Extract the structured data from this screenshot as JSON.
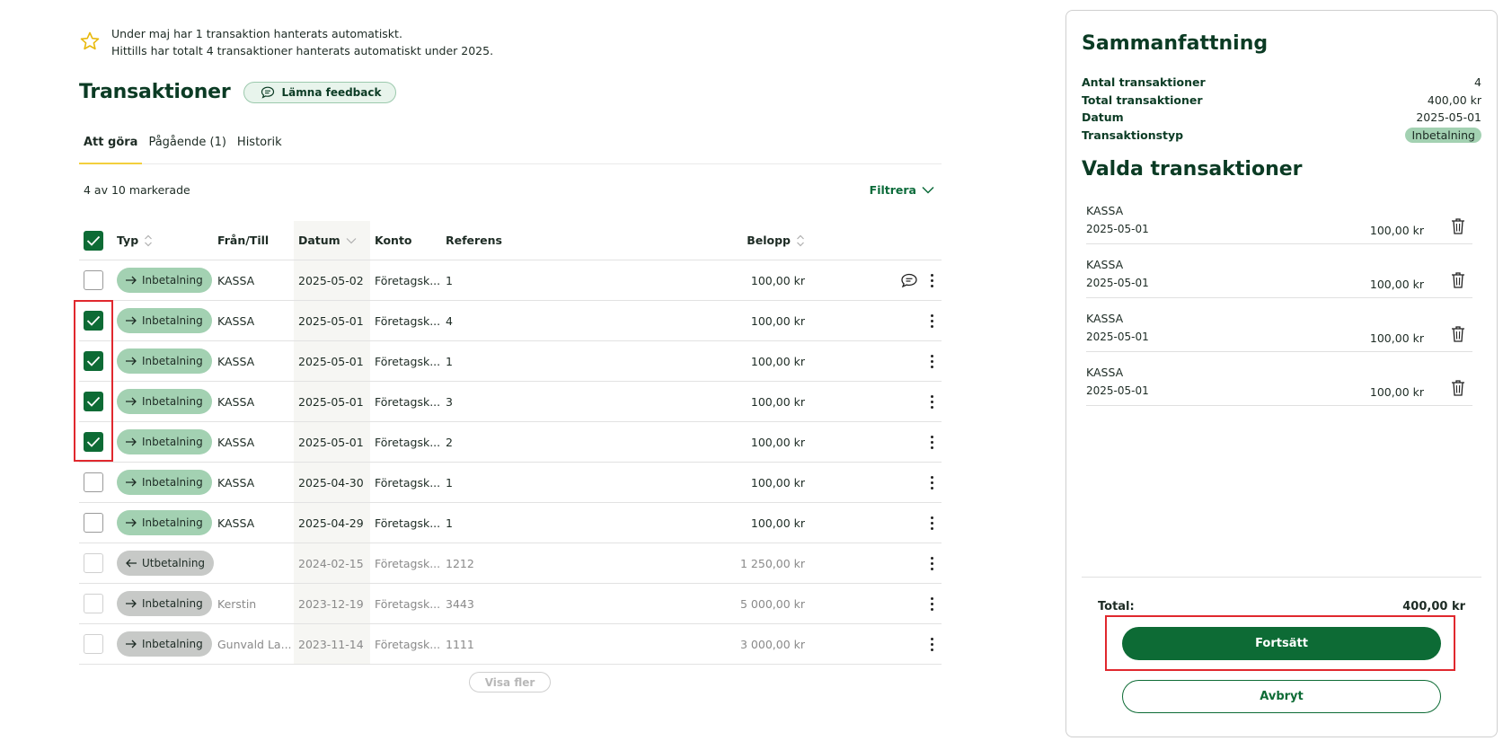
{
  "info": {
    "line1": "Under maj har 1 transaktion hanterats automatiskt.",
    "line2": "Hittills har totalt 4 transaktioner hanterats automatiskt under 2025."
  },
  "page": {
    "title": "Transaktioner",
    "feedback_label": "Lämna feedback"
  },
  "tabs": [
    {
      "label": "Att göra",
      "active": true
    },
    {
      "label": "Pågående (1)",
      "active": false
    },
    {
      "label": "Historik",
      "active": false
    }
  ],
  "toolbar": {
    "marked_text": "4 av 10 markerade",
    "filter_label": "Filtrera"
  },
  "table": {
    "headers": {
      "type": "Typ",
      "from_to": "Från/Till",
      "date": "Datum",
      "account": "Konto",
      "reference": "Referens",
      "amount": "Belopp"
    },
    "rows": [
      {
        "checked": false,
        "type": "Inbetalning",
        "direction": "in",
        "from_to": "KASSA",
        "date": "2025-05-02",
        "account": "Företagsk...",
        "reference": "1",
        "amount": "100,00 kr",
        "muted": false,
        "has_comment": true
      },
      {
        "checked": true,
        "type": "Inbetalning",
        "direction": "in",
        "from_to": "KASSA",
        "date": "2025-05-01",
        "account": "Företagsk...",
        "reference": "4",
        "amount": "100,00 kr",
        "muted": false,
        "has_comment": false
      },
      {
        "checked": true,
        "type": "Inbetalning",
        "direction": "in",
        "from_to": "KASSA",
        "date": "2025-05-01",
        "account": "Företagsk...",
        "reference": "1",
        "amount": "100,00 kr",
        "muted": false,
        "has_comment": false
      },
      {
        "checked": true,
        "type": "Inbetalning",
        "direction": "in",
        "from_to": "KASSA",
        "date": "2025-05-01",
        "account": "Företagsk...",
        "reference": "3",
        "amount": "100,00 kr",
        "muted": false,
        "has_comment": false
      },
      {
        "checked": true,
        "type": "Inbetalning",
        "direction": "in",
        "from_to": "KASSA",
        "date": "2025-05-01",
        "account": "Företagsk...",
        "reference": "2",
        "amount": "100,00 kr",
        "muted": false,
        "has_comment": false
      },
      {
        "checked": false,
        "type": "Inbetalning",
        "direction": "in",
        "from_to": "KASSA",
        "date": "2025-04-30",
        "account": "Företagsk...",
        "reference": "1",
        "amount": "100,00 kr",
        "muted": false,
        "has_comment": false
      },
      {
        "checked": false,
        "type": "Inbetalning",
        "direction": "in",
        "from_to": "KASSA",
        "date": "2025-04-29",
        "account": "Företagsk...",
        "reference": "1",
        "amount": "100,00 kr",
        "muted": false,
        "has_comment": false
      },
      {
        "checked": false,
        "type": "Utbetalning",
        "direction": "out",
        "from_to": "",
        "date": "2024-02-15",
        "account": "Företagsk...",
        "reference": "1212",
        "amount": "1 250,00 kr",
        "muted": true,
        "has_comment": false
      },
      {
        "checked": false,
        "type": "Inbetalning",
        "direction": "in",
        "from_to": "Kerstin",
        "date": "2023-12-19",
        "account": "Företagsk...",
        "reference": "3443",
        "amount": "5 000,00 kr",
        "muted": true,
        "has_comment": false
      },
      {
        "checked": false,
        "type": "Inbetalning",
        "direction": "in",
        "from_to": "Gunvald La...",
        "date": "2023-11-14",
        "account": "Företagsk...",
        "reference": "1111",
        "amount": "3 000,00 kr",
        "muted": true,
        "has_comment": false
      }
    ],
    "show_more_label": "Visa fler"
  },
  "summary": {
    "title": "Sammanfattning",
    "rows": [
      {
        "label": "Antal transaktioner",
        "value": "4"
      },
      {
        "label": "Total transaktioner",
        "value": "400,00 kr"
      },
      {
        "label": "Datum",
        "value": "2025-05-01"
      },
      {
        "label": "Transaktionstyp",
        "value": "Inbetalning"
      }
    ],
    "selected_title": "Valda transaktioner",
    "selected": [
      {
        "name": "KASSA",
        "date": "2025-05-01",
        "amount": "100,00 kr"
      },
      {
        "name": "KASSA",
        "date": "2025-05-01",
        "amount": "100,00 kr"
      },
      {
        "name": "KASSA",
        "date": "2025-05-01",
        "amount": "100,00 kr"
      },
      {
        "name": "KASSA",
        "date": "2025-05-01",
        "amount": "100,00 kr"
      }
    ],
    "total_label": "Total:",
    "total_value": "400,00 kr",
    "continue_label": "Fortsätt",
    "cancel_label": "Avbryt"
  },
  "colors": {
    "brand_green": "#0d6b35",
    "pill_green": "#a3d1b2",
    "pill_gray": "#c7c9c7",
    "highlight_red": "#e0282e",
    "tab_underline": "#f3cf3d"
  }
}
